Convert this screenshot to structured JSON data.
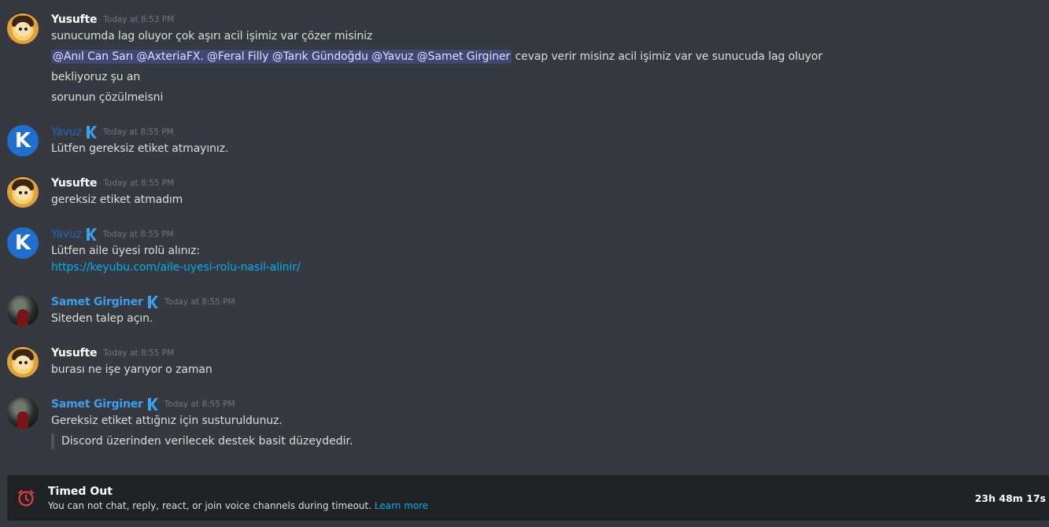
{
  "messages": [
    {
      "author": "Yusufte",
      "time": "Today at 8:53 PM",
      "lines": [
        "sunucumda lag oluyor çok aşırı acil işimiz var çözer misiniz"
      ],
      "mentions_line": {
        "mentions": [
          "@Anıl Can Sarı",
          "@AxteriaFX.",
          "@Feral Filly",
          "@Tarık Gündoğdu",
          "@Yavuz",
          "@Samet Girginer"
        ],
        "trailing": "cevap verir misinz acil işimiz var ve sunucuda lag oluyor"
      },
      "after_lines": [
        "bekliyoruz şu an",
        "sorunun çözülmeisni"
      ]
    },
    {
      "author": "Yavuz",
      "time": "Today at 8:55 PM",
      "lines": [
        "Lütfen gereksiz etiket atmayınız."
      ]
    },
    {
      "author": "Yusufte",
      "time": "Today at 8:55 PM",
      "lines": [
        "gereksiz etiket atmadım"
      ]
    },
    {
      "author": "Yavuz",
      "time": "Today at 8:55 PM",
      "lines": [
        "Lütfen aile üyesi rolü alınız:"
      ],
      "link": "https://keyubu.com/aile-uyesi-rolu-nasil-alinir/"
    },
    {
      "author": "Samet Girginer",
      "time": "Today at 8:55 PM",
      "lines": [
        "Siteden talep açın."
      ]
    },
    {
      "author": "Yusufte",
      "time": "Today at 8:55 PM",
      "lines": [
        "burası ne işe yarıyor o zaman"
      ]
    },
    {
      "author": "Samet Girginer",
      "time": "Today at 8:55 PM",
      "lines": [
        "Gereksiz etiket attığnız için susturuldunuz."
      ],
      "quote": "Discord üzerinden verilecek destek basit düzeydedir."
    }
  ],
  "timeout": {
    "title": "Timed Out",
    "description": "You can not chat, reply, react, or join voice channels during timeout.",
    "learn_more": "Learn more",
    "remaining": "23h 48m 17s"
  },
  "colors": {
    "background": "#36393f",
    "mention_bg": "#414675",
    "link": "#00b0f4",
    "moderator_name": "#3aa0f0",
    "timeout_icon": "#ed4245"
  },
  "icons": {
    "moderator_badge": "k-logo-icon",
    "timeout": "clock-alert-icon"
  }
}
